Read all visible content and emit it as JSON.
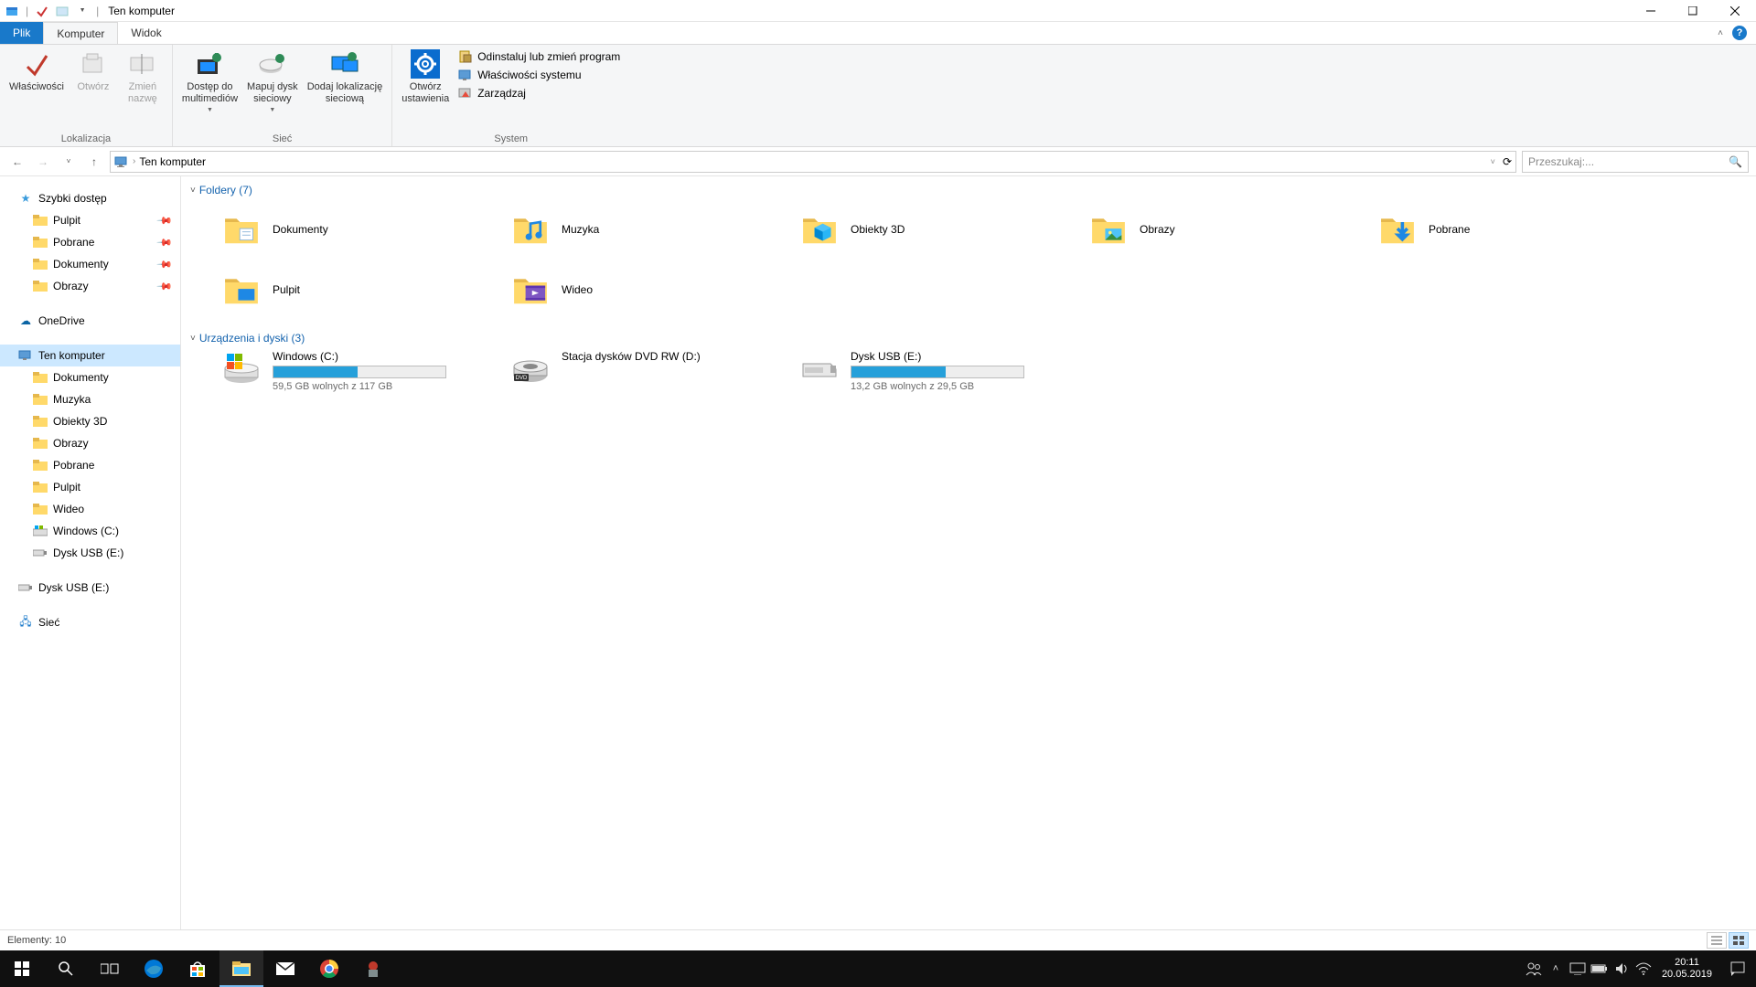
{
  "window": {
    "title": "Ten komputer"
  },
  "tabs": {
    "file": "Plik",
    "computer": "Komputer",
    "view": "Widok"
  },
  "ribbon": {
    "group_location": {
      "label": "Lokalizacja",
      "properties": "Właściwości",
      "open": "Otwórz",
      "rename": "Zmień\nnazwę"
    },
    "group_network": {
      "label": "Sieć",
      "media": "Dostęp do\nmultimediów",
      "map": "Mapuj dysk\nsieciowy",
      "addloc": "Dodaj lokalizację\nsieciową"
    },
    "group_system": {
      "label": "System",
      "settings": "Otwórz\nustawienia",
      "uninstall": "Odinstaluj lub zmień program",
      "sysprops": "Właściwości systemu",
      "manage": "Zarządzaj"
    }
  },
  "nav": {
    "location": "Ten komputer",
    "search_placeholder": "Przeszukaj:..."
  },
  "tree": {
    "quick": "Szybki dostęp",
    "quick_items": [
      "Pulpit",
      "Pobrane",
      "Dokumenty",
      "Obrazy"
    ],
    "onedrive": "OneDrive",
    "thispc": "Ten komputer",
    "thispc_items": [
      "Dokumenty",
      "Muzyka",
      "Obiekty 3D",
      "Obrazy",
      "Pobrane",
      "Pulpit",
      "Wideo",
      "Windows (C:)",
      "Dysk USB (E:)"
    ],
    "usb": "Dysk USB (E:)",
    "network": "Sieć"
  },
  "content": {
    "folders_header": "Foldery (7)",
    "folders": [
      "Dokumenty",
      "Muzyka",
      "Obiekty 3D",
      "Obrazy",
      "Pobrane",
      "Pulpit",
      "Wideo"
    ],
    "drives_header": "Urządzenia i dyski (3)",
    "drives": [
      {
        "name": "Windows (C:)",
        "free": "59,5 GB wolnych z 117 GB",
        "fill": 49
      },
      {
        "name": "Stacja dysków DVD RW (D:)",
        "free": "",
        "fill": null
      },
      {
        "name": "Dysk USB (E:)",
        "free": "13,2 GB wolnych z 29,5 GB",
        "fill": 55
      }
    ]
  },
  "status": {
    "items": "Elementy: 10"
  },
  "taskbar": {
    "time": "20:11",
    "date": "20.05.2019"
  }
}
